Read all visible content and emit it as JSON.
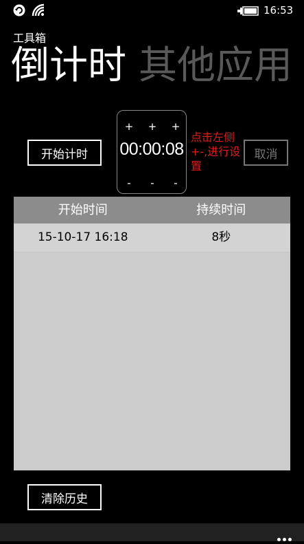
{
  "status_bar": {
    "time": "16:53"
  },
  "app": {
    "title": "工具箱",
    "pivot": [
      "倒计时",
      "其他应用"
    ]
  },
  "controls": {
    "start_label": "开始计时",
    "cancel_label": "取消",
    "clear_label": "清除历史"
  },
  "timer": {
    "value": "00:00:08",
    "plus": "+",
    "minus": "-"
  },
  "hint": "点击左侧+-,进行设置",
  "history": {
    "columns": [
      "开始时间",
      "持续时间"
    ],
    "rows": [
      {
        "start": "15-10-17 16:18",
        "duration": "8秒"
      }
    ]
  },
  "icons": {
    "status": [
      "sync-icon",
      "wifi-icon",
      "battery-icon"
    ],
    "appbar": "more-icon"
  }
}
